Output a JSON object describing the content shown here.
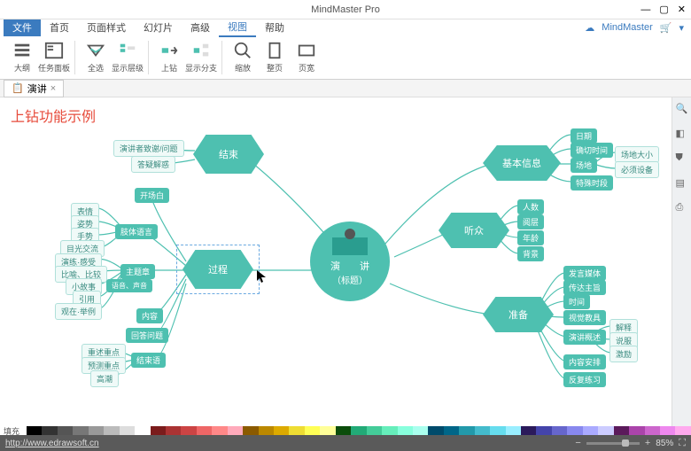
{
  "app_title": "MindMaster Pro",
  "menubar": {
    "file": "文件",
    "tabs": [
      "首页",
      "页面样式",
      "幻灯片",
      "高级",
      "视图",
      "帮助"
    ],
    "active": 4,
    "brand": "MindMaster"
  },
  "ribbon": [
    {
      "name": "outline",
      "label": "大纲"
    },
    {
      "name": "taskpanel",
      "label": "任务面板"
    },
    {
      "name": "fullscreen",
      "label": "全选"
    },
    {
      "name": "showlevel",
      "label": "显示层级"
    },
    {
      "name": "drill",
      "label": "上钻"
    },
    {
      "name": "showbranch",
      "label": "显示分支"
    },
    {
      "name": "zoom",
      "label": "缩放"
    },
    {
      "name": "fitpage",
      "label": "整页"
    },
    {
      "name": "pagewidth",
      "label": "页宽"
    }
  ],
  "doc_tab": "演讲",
  "canvas_title": "上钻功能示例",
  "center": {
    "line1": "演　　讲",
    "line2": "（标题）"
  },
  "main_nodes": {
    "end": "结束",
    "process": "过程",
    "basic": "基本信息",
    "audience": "听众",
    "prepare": "准备"
  },
  "leaves": {
    "end": [
      "演讲者致谢/问题",
      "答疑解惑"
    ],
    "proc_open": "开场白",
    "proc_body_lang": "肢体语言",
    "proc_body_items": [
      "表情",
      "姿势",
      "手势",
      "目光交流"
    ],
    "proc_main": "主题章",
    "proc_main_items": [
      "演练·感受",
      "比喻、比较",
      "小故事",
      "引用",
      "观在·举例"
    ],
    "proc_voice": "语音、声音",
    "proc_content": "内容",
    "proc_review": "回答问题",
    "proc_summary": "结束语",
    "proc_summary_items": [
      "重述重点",
      "预测重点",
      "高潮"
    ],
    "basic": [
      "日期",
      "确切时间",
      "场地",
      "特殊时段"
    ],
    "basic_sub": [
      "场地大小",
      "必须设备"
    ],
    "audience": [
      "人数",
      "阅层",
      "年龄",
      "背景"
    ],
    "prepare": [
      "发言媒体",
      "传达主旨",
      "时间",
      "视觉教具",
      "演讲概述",
      "内容安排",
      "反复练习"
    ],
    "prepare_sub": [
      "解释",
      "说服",
      "激励"
    ]
  },
  "status": {
    "url": "http://www.edrawsoft.cn",
    "zoom": "85%"
  },
  "sel_label": "填充"
}
